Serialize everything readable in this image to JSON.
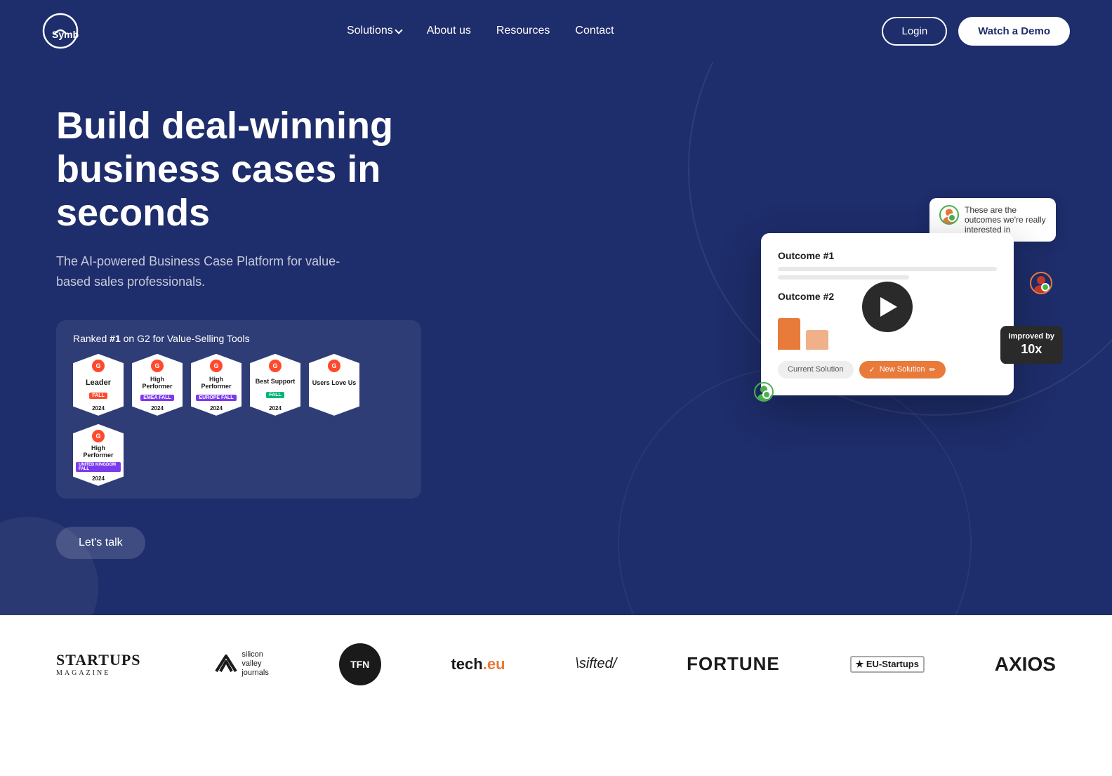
{
  "brand": {
    "name": "Symbe"
  },
  "nav": {
    "links": [
      {
        "label": "Solutions",
        "has_dropdown": true
      },
      {
        "label": "About us",
        "has_dropdown": false
      },
      {
        "label": "Resources",
        "has_dropdown": false
      },
      {
        "label": "Contact",
        "has_dropdown": false
      }
    ],
    "cta_login": "Login",
    "cta_demo": "Watch a Demo"
  },
  "hero": {
    "title": "Build deal-winning business cases in seconds",
    "subtitle": "The AI-powered Business Case Platform for value-based sales professionals.",
    "g2": {
      "ranked_text_pre": "Ranked ",
      "ranked_highlight": "#1",
      "ranked_text_post": " on G2 for Value-Selling Tools",
      "badges": [
        {
          "title": "Leader",
          "sub": "FALL",
          "sub_color": "red",
          "year": "2024"
        },
        {
          "title": "High Performer",
          "sub": "EMEA FALL",
          "sub_color": "purple",
          "year": "2024"
        },
        {
          "title": "High Performer",
          "sub": "Europe FALL",
          "sub_color": "purple",
          "year": "2024"
        },
        {
          "title": "Best Support",
          "sub": "FALL",
          "sub_color": "green",
          "year": "2024"
        },
        {
          "title": "Users Love Us",
          "sub": "",
          "sub_color": "red",
          "year": ""
        },
        {
          "title": "High Performer",
          "sub": "United Kingdom FALL",
          "sub_color": "purple",
          "year": "2024"
        }
      ]
    },
    "cta_lets_talk": "Let's talk"
  },
  "mockup": {
    "outcome1": "Outcome #1",
    "outcome2": "Outcome #2",
    "tooltip_text": "These are the outcomes we're really interested in",
    "current_solution": "Current Solution",
    "new_solution": "New Solution",
    "improved_label": "Improved by",
    "improved_value": "10x"
  },
  "logos": [
    {
      "name": "STARTUPS MAGAZINE",
      "type": "text_stacked"
    },
    {
      "name": "silicon valley journals",
      "type": "svj"
    },
    {
      "name": "TFN",
      "type": "circle"
    },
    {
      "name": "tech.eu",
      "type": "techeu"
    },
    {
      "name": "\\sifted/",
      "type": "sifted"
    },
    {
      "name": "FORTUNE",
      "type": "fortune"
    },
    {
      "name": "EU-Startups",
      "type": "eustartups"
    },
    {
      "name": "AXIOS",
      "type": "axios"
    }
  ]
}
